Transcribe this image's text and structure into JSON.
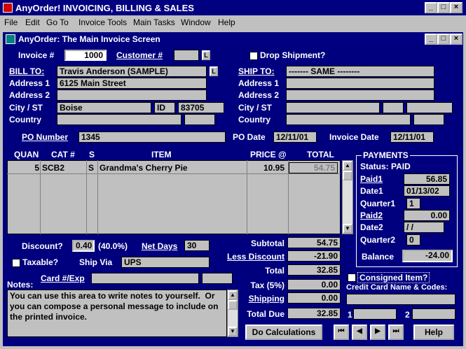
{
  "app": {
    "title": "AnyOrder! INVOICING, BILLING & SALES"
  },
  "menu": [
    "File",
    "Edit",
    "Go To",
    "Invoice Tools",
    "Main Tasks",
    "Window",
    "Help"
  ],
  "window": {
    "title": "AnyOrder: The Main Invoice Screen"
  },
  "invoice": {
    "label": "Invoice #",
    "number": "1000",
    "customer_label": "Customer #",
    "customer": "",
    "lookup": "L",
    "drop_ship_label": "Drop Shipment?"
  },
  "bill_to": {
    "label": "BILL TO:",
    "name": "Travis Anderson (SAMPLE)",
    "lookup": "L",
    "addr1_label": "Address 1",
    "addr1": "6125 Main Street",
    "addr2_label": "Address 2",
    "addr2": "",
    "city_label": "City / ST",
    "city": "Boise",
    "state": "ID",
    "zip": "83705",
    "country_label": "Country",
    "country": ""
  },
  "ship_to": {
    "label": "SHIP TO:",
    "name": "------- SAME --------",
    "addr1_label": "Address 1",
    "addr2_label": "Address 2",
    "city_label": "City / ST",
    "country_label": "Country"
  },
  "po": {
    "number_label": "PO Number",
    "number": "1345",
    "date_label": "PO Date",
    "date": "12/11/01",
    "invoice_date_label": "Invoice Date",
    "invoice_date": "12/11/01"
  },
  "items": {
    "headers": {
      "quan": "QUAN",
      "cat": "CAT #",
      "s": "S",
      "item": "ITEM",
      "price": "PRICE @",
      "total": "TOTAL"
    },
    "rows": [
      {
        "quan": "5",
        "cat": "SCB2",
        "s": "S",
        "item": "Grandma's Cherry Pie",
        "price": "10.95",
        "total": "54.75"
      }
    ]
  },
  "payments": {
    "header": "PAYMENTS",
    "status": "Status: PAID",
    "paid1_label": "Paid1",
    "paid1": "56.85",
    "date1_label": "Date1",
    "date1": "01/13/02",
    "quarter1_label": "Quarter1",
    "quarter1": "1",
    "paid2_label": "Paid2",
    "paid2": "0.00",
    "date2_label": "Date2",
    "date2": "  /  /",
    "quarter2_label": "Quarter2",
    "quarter2": "0",
    "balance_label": "Balance",
    "balance": "-24.00"
  },
  "terms": {
    "discount_label": "Discount?",
    "discount": "0.40",
    "discount_pct": "(40.0%)",
    "net_days_label": "Net Days",
    "net_days": "30",
    "taxable_label": "Taxable?",
    "ship_via_label": "Ship Via",
    "ship_via": "UPS",
    "card_label": "Card #/Exp",
    "card": "",
    "card_exp": ""
  },
  "totals": {
    "subtotal_label": "Subtotal",
    "subtotal": "54.75",
    "less_discount_label": "Less Discount",
    "less_discount": "-21.90",
    "total_label": "Total",
    "total": "32.85",
    "tax_label": "Tax (5%)",
    "tax": "0.00",
    "shipping_label": "Shipping",
    "shipping": "0.00",
    "total_due_label": "Total Due",
    "total_due": "32.85"
  },
  "consigned": {
    "label": "Consigned Item?",
    "cc_label": "Credit Card Name & Codes:",
    "code1_label": "1",
    "code2_label": "2"
  },
  "notes": {
    "label": "Notes:",
    "text": "You can use this area to write notes to yourself.  Or you can compose a personal message to include on the printed invoice."
  },
  "buttons": {
    "calc": "Do Calculations",
    "first": "⏮",
    "prev": "◀",
    "next": "▶",
    "last": "⏭",
    "help": "Help"
  }
}
